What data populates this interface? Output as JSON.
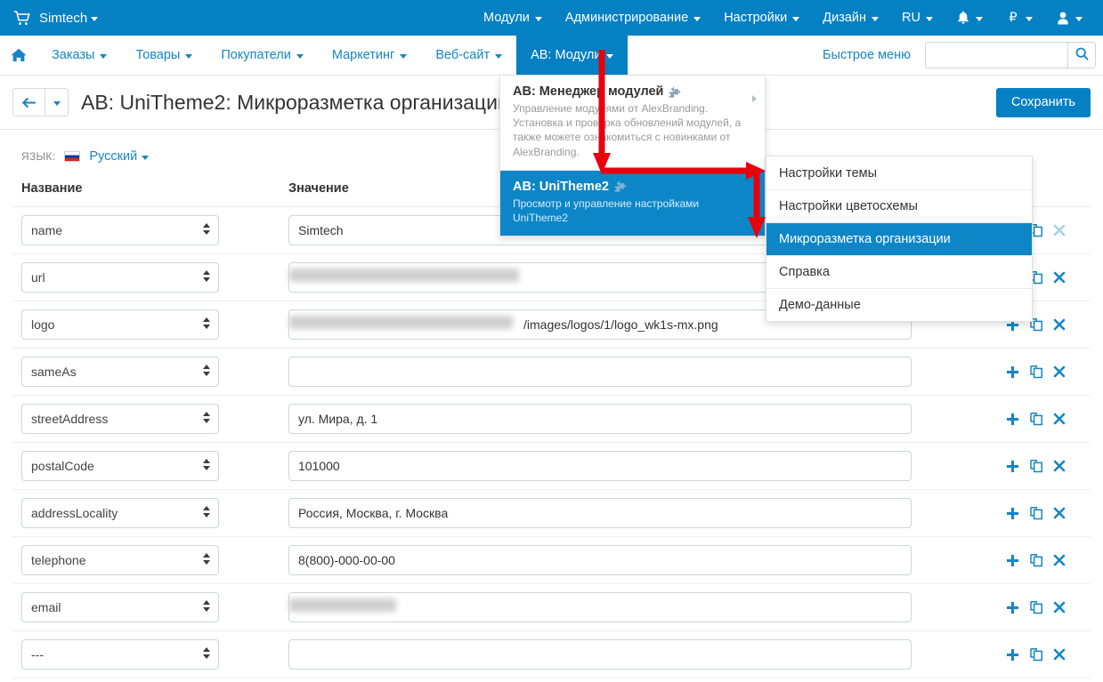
{
  "topbar": {
    "cart_icon": "cart-icon",
    "store_name": "Simtech",
    "items": [
      {
        "label": "Модули",
        "name": "modules"
      },
      {
        "label": "Администрирование",
        "name": "administration"
      },
      {
        "label": "Настройки",
        "name": "settings"
      },
      {
        "label": "Дизайн",
        "name": "design"
      },
      {
        "label": "RU",
        "name": "language"
      }
    ],
    "bell_icon": "bell-icon",
    "currency_symbol": "₽",
    "user_icon": "user-icon"
  },
  "mainnav": {
    "home_icon": "home-icon",
    "items": [
      {
        "label": "Заказы",
        "name": "orders",
        "active": false
      },
      {
        "label": "Товары",
        "name": "products",
        "active": false
      },
      {
        "label": "Покупатели",
        "name": "customers",
        "active": false
      },
      {
        "label": "Маркетинг",
        "name": "marketing",
        "active": false
      },
      {
        "label": "Веб-сайт",
        "name": "website",
        "active": false
      },
      {
        "label": "AB: Модули",
        "name": "ab-modules",
        "active": true
      }
    ],
    "quick_menu": "Быстрое меню",
    "search_value": "",
    "search_placeholder": "",
    "search_icon": "search-icon"
  },
  "ab_dropdown": {
    "items": [
      {
        "title": "AB: Менеджер модулей",
        "desc": "Управление модулями от AlexBranding. Установка и проверка обновлений модулей, а также можете ознакомиться с новинками от AlexBranding.",
        "selected": false,
        "icon": "puzzle-piece-icon"
      },
      {
        "title": "AB: UniTheme2",
        "desc": "Просмотр и управление настройками UniTheme2",
        "selected": true,
        "icon": "puzzle-piece-icon"
      }
    ]
  },
  "ab_submenu": {
    "items": [
      {
        "label": "Настройки темы",
        "selected": false
      },
      {
        "label": "Настройки цветосхемы",
        "selected": false
      },
      {
        "label": "Микроразметка организации",
        "selected": true
      },
      {
        "label": "Справка",
        "selected": false
      },
      {
        "label": "Демо-данные",
        "selected": false
      }
    ]
  },
  "titlebar": {
    "back_icon": "arrow-left-icon",
    "back_caret_icon": "chevron-down-icon",
    "title": "AB: UniTheme2: Микроразметка организации",
    "save_label": "Сохранить"
  },
  "language_row": {
    "label": "ЯЗЫК:",
    "flag": "ru-flag-icon",
    "value": "Русский"
  },
  "table": {
    "headers": {
      "name": "Название",
      "value": "Значение",
      "actions": ""
    },
    "action_icons": {
      "add": "plus-icon",
      "clone": "copy-icon",
      "remove": "close-icon"
    },
    "rows": [
      {
        "name": "name",
        "value": "Simtech",
        "redacted": 0,
        "remove_disabled": true
      },
      {
        "name": "url",
        "value": "",
        "redacted": 258,
        "remove_disabled": false
      },
      {
        "name": "logo",
        "value": "/images/logos/1/logo_wk1s-mx.png",
        "redacted": 251,
        "redact_prefix": true,
        "remove_disabled": false
      },
      {
        "name": "sameAs",
        "value": "",
        "redacted": 0,
        "remove_disabled": false
      },
      {
        "name": "streetAddress",
        "value": "ул. Мира, д. 1",
        "redacted": 0,
        "remove_disabled": false
      },
      {
        "name": "postalCode",
        "value": "101000",
        "redacted": 0,
        "remove_disabled": false
      },
      {
        "name": "addressLocality",
        "value": "Россия, Москва, г. Москва",
        "redacted": 0,
        "remove_disabled": false
      },
      {
        "name": "telephone",
        "value": "8(800)-000-00-00",
        "redacted": 0,
        "remove_disabled": false
      },
      {
        "name": "email",
        "value": "",
        "redacted": 120,
        "remove_disabled": false
      },
      {
        "name": "---",
        "value": "",
        "redacted": 0,
        "remove_disabled": false
      }
    ]
  },
  "annotations": {
    "color": "#e8000d",
    "description": "red arrows pointing from AB: Модули tab to AB: UniTheme2 item, then right to submenu, then down to Микроразметка организации"
  }
}
